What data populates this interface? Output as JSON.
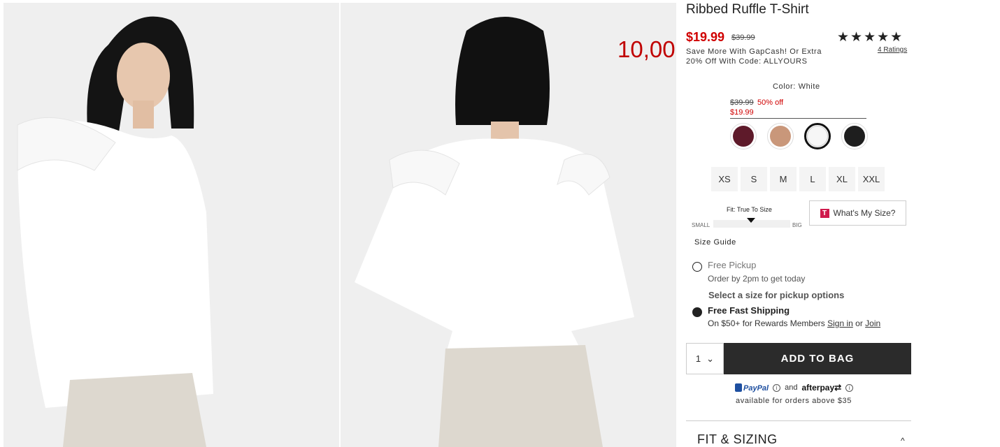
{
  "product": {
    "title": "Ribbed Ruffle T-Shirt",
    "sale_price": "$19.99",
    "original_price": "$39.99",
    "promo_line1": "Save More With GapCash! Or Extra",
    "promo_line2": "20% Off With Code: ALLYOURS",
    "stars": "★★★★★",
    "rating_count": "4 Ratings",
    "overlay_price": "10,00"
  },
  "color": {
    "label": "Color: White",
    "old_price": "$39.99",
    "discount": "50% off",
    "new_price": "$19.99",
    "swatches": [
      {
        "name": "burgundy",
        "hex": "#5e1a2a"
      },
      {
        "name": "tan",
        "hex": "#c9977a"
      },
      {
        "name": "white",
        "hex": "#f6f6f6"
      },
      {
        "name": "black",
        "hex": "#1e1e1e"
      }
    ]
  },
  "sizes": [
    "XS",
    "S",
    "M",
    "L",
    "XL",
    "XXL"
  ],
  "fit": {
    "title": "Fit: True To Size",
    "small": "SMALL",
    "big": "BIG",
    "whats_my_size": "What's My Size?",
    "t_icon": "T",
    "size_guide": "Size Guide"
  },
  "delivery": {
    "pickup_title": "Free Pickup",
    "pickup_sub": "Order by 2pm to get today",
    "pickup_note": "Select a size for pickup options",
    "ship_title": "Free Fast Shipping",
    "ship_sub": "On $50+ for Rewards Members",
    "sign_in": "Sign in",
    "or": "or",
    "join": "Join"
  },
  "cart": {
    "qty": "1",
    "chevron": "⌄",
    "add_label": "ADD TO BAG"
  },
  "payment": {
    "paypal": "PayPal",
    "and": "and",
    "afterpay": "afterpay",
    "afterpay_glyph": "⇄",
    "info": "i",
    "available": "available for orders above $35"
  },
  "accordion": {
    "fit_sizing": "FIT & SIZING",
    "chevron": "^"
  },
  "colors": {
    "sale_red": "#d00000",
    "button_dark": "#2b2b2b",
    "overlay_red": "#c00000"
  }
}
